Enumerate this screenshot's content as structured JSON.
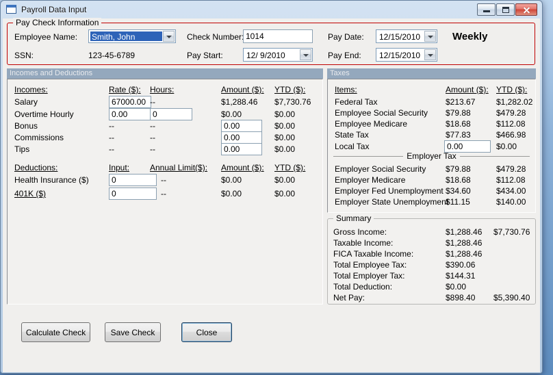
{
  "window": {
    "title": "Payroll Data Input"
  },
  "paycheck": {
    "group_title": "Pay Check Information",
    "employee_name_label": "Employee Name:",
    "employee_name_value": "Smith, John",
    "ssn_label": "SSN:",
    "ssn_value": "123-45-6789",
    "check_number_label": "Check Number:",
    "check_number_value": "1014",
    "pay_start_label": "Pay Start:",
    "pay_start_value": "12/ 9/2010",
    "pay_date_label": "Pay Date:",
    "pay_date_value": "12/15/2010",
    "pay_end_label": "Pay End:",
    "pay_end_value": "12/15/2010",
    "frequency": "Weekly"
  },
  "incomes": {
    "section_header": "Incomes and Deductions",
    "col_item": "Incomes:",
    "col_rate": "Rate ($):",
    "col_hours": "Hours:",
    "col_amount": "Amount ($):",
    "col_ytd": "YTD ($):",
    "salary": {
      "label": "Salary",
      "rate": "67000.00",
      "hours": "--",
      "amount": "$1,288.46",
      "ytd": "$7,730.76"
    },
    "overtime": {
      "label": "Overtime Hourly",
      "rate": "0.00",
      "hours": "0",
      "amount": "$0.00",
      "ytd": "$0.00"
    },
    "bonus": {
      "label": "Bonus",
      "rate": "--",
      "hours": "--",
      "amount": "0.00",
      "ytd": "$0.00"
    },
    "commissions": {
      "label": "Commissions",
      "rate": "--",
      "hours": "--",
      "amount": "0.00",
      "ytd": "$0.00"
    },
    "tips": {
      "label": "Tips",
      "rate": "--",
      "hours": "--",
      "amount": "0.00",
      "ytd": "$0.00"
    }
  },
  "deductions": {
    "col_item": "Deductions:",
    "col_input": "Input:",
    "col_limit": "Annual Limit($):",
    "col_amount": "Amount ($):",
    "col_ytd": "YTD ($):",
    "health": {
      "label": "Health Insurance ($)",
      "input": "0",
      "limit": "--",
      "amount": "$0.00",
      "ytd": "$0.00"
    },
    "k401": {
      "label": "401K ($)",
      "input": "0",
      "limit": "--",
      "amount": "$0.00",
      "ytd": "$0.00"
    }
  },
  "taxes": {
    "section_header": "Taxes",
    "col_item": "Items:",
    "col_amount": "Amount ($):",
    "col_ytd": "YTD ($):",
    "federal": {
      "label": "Federal Tax",
      "amount": "$213.67",
      "ytd": "$1,282.02"
    },
    "emp_ss": {
      "label": "Employee Social Security",
      "amount": "$79.88",
      "ytd": "$479.28"
    },
    "emp_medicare": {
      "label": "Employee Medicare",
      "amount": "$18.68",
      "ytd": "$112.08"
    },
    "state": {
      "label": "State Tax",
      "amount": "$77.83",
      "ytd": "$466.98"
    },
    "local": {
      "label": "Local Tax",
      "amount": "0.00",
      "ytd": "$0.00"
    },
    "employer_header": "Employer Tax",
    "er_ss": {
      "label": "Employer Social Security",
      "amount": "$79.88",
      "ytd": "$479.28"
    },
    "er_medicare": {
      "label": "Employer Medicare",
      "amount": "$18.68",
      "ytd": "$112.08"
    },
    "er_fed": {
      "label": "Employer Fed Unemployment",
      "amount": "$34.60",
      "ytd": "$434.00"
    },
    "er_state": {
      "label": "Employer State Unemployment",
      "amount": "$11.15",
      "ytd": "$140.00"
    }
  },
  "summary": {
    "group_title": "Summary",
    "gross": {
      "label": "Gross Income:",
      "amount": "$1,288.46",
      "ytd": "$7,730.76"
    },
    "taxable": {
      "label": "Taxable Income:",
      "amount": "$1,288.46"
    },
    "fica": {
      "label": "FICA Taxable Income:",
      "amount": "$1,288.46"
    },
    "tot_emp": {
      "label": "Total Employee Tax:",
      "amount": "$390.06"
    },
    "tot_er": {
      "label": "Total Employer Tax:",
      "amount": "$144.31"
    },
    "tot_ded": {
      "label": "Total Deduction:",
      "amount": "$0.00"
    },
    "net_pay": {
      "label": "Net Pay:",
      "amount": "$898.40",
      "ytd": "$5,390.40"
    }
  },
  "buttons": {
    "calculate": "Calculate Check",
    "save": "Save Check",
    "close": "Close"
  },
  "colors": {
    "paycheck_group_border": "#c00000",
    "section_header_bg": "#94a8bd",
    "combo_selection_blue": "#2e63b8",
    "close_button_red": "#cf4437",
    "desktop_blue": "#5d8cbe"
  }
}
